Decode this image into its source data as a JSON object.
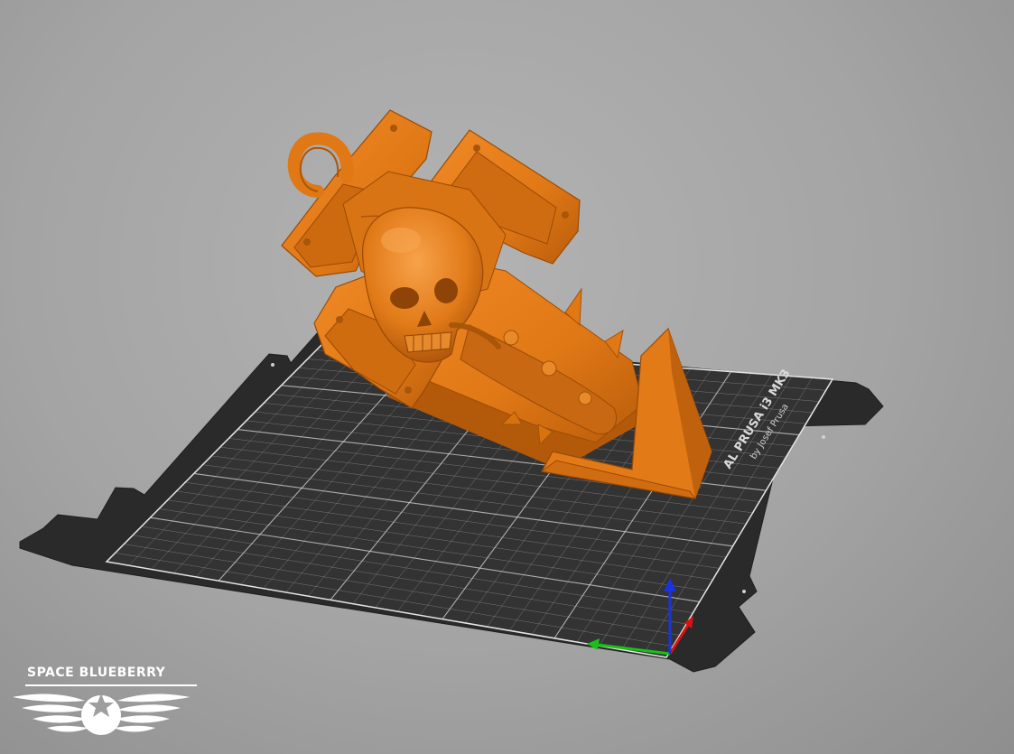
{
  "app": {
    "view": "3D plater viewport"
  },
  "bed": {
    "label": "AL PRUSA i3 MK3",
    "sub_label": "by Josef Prusa",
    "surface_color": "#2f2f2f",
    "grid_color": "#d8d8d8"
  },
  "model": {
    "color": "#e07816",
    "shade_color": "#b65a0a",
    "highlight_color": "#f59a3a"
  },
  "axes": {
    "x_color": "#e01010",
    "y_color": "#18c018",
    "z_color": "#1a33e0"
  },
  "watermark": {
    "text": "SPACE BLUEBERRY"
  }
}
